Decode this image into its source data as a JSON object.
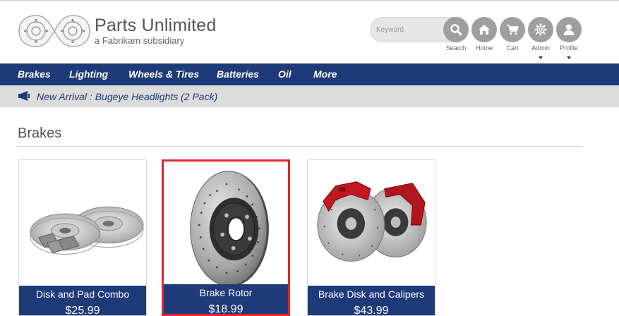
{
  "brand": {
    "title": "Parts Unlimited",
    "subtitle": "a Fabrikam subsidiary"
  },
  "search": {
    "placeholder": "Keyword",
    "label": "Search"
  },
  "header_icons": [
    {
      "label": "Home",
      "icon": "home-icon"
    },
    {
      "label": "Cart",
      "icon": "cart-icon"
    },
    {
      "label": "Admin",
      "icon": "gear-icon"
    },
    {
      "label": "Profile",
      "icon": "user-icon"
    }
  ],
  "nav": [
    "Brakes",
    "Lighting",
    "Wheels & Tires",
    "Batteries",
    "Oil",
    "More"
  ],
  "announcement": {
    "icon": "megaphone-icon",
    "text": "New Arrival : Bugeye Headlights (2 Pack)"
  },
  "section": {
    "title": "Brakes"
  },
  "products": [
    {
      "name": "Disk and Pad Combo",
      "price": "$25.99"
    },
    {
      "name": "Brake Rotor",
      "price": "$18.99",
      "selected": true
    },
    {
      "name": "Brake Disk and Calipers",
      "price": "$43.99"
    }
  ],
  "colors": {
    "nav": "#1e3a78",
    "selection": "#e0262e",
    "icon_bg": "#9f9f9f"
  }
}
